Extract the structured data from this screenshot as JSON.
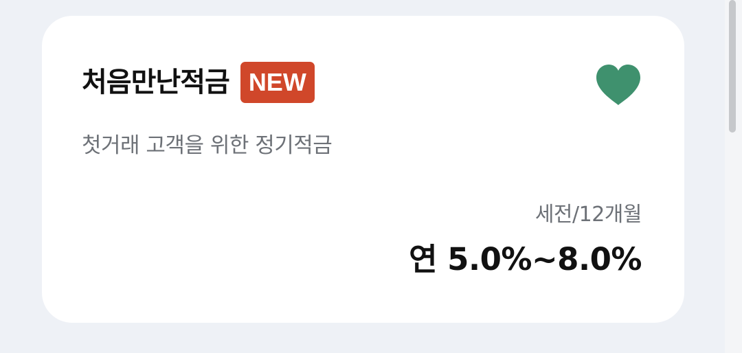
{
  "product": {
    "name": "처음만난적금",
    "badge": "NEW",
    "description": "첫거래 고객을 위한 정기적금",
    "rate_period": "세전/12개월",
    "rate_value": "연 5.0%~8.0%",
    "favorite_icon": "heart-icon",
    "favorite_color": "#3f916e",
    "badge_color": "#d0472a"
  }
}
